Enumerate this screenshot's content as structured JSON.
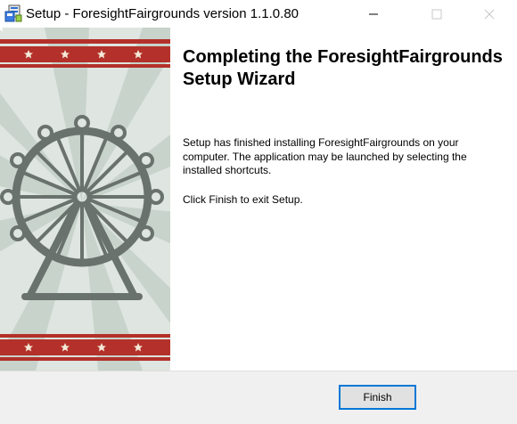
{
  "window": {
    "title": "Setup - ForesightFairgrounds version 1.1.0.80",
    "app_icon": "installer-box-icon",
    "controls": [
      "minimize-icon",
      "maximize-icon",
      "close-icon"
    ]
  },
  "banner": {
    "illustration": "ferris-wheel-illustration",
    "colors": {
      "background": "#dfe5e0",
      "ray": "#c7d3cb",
      "stripe": "#b3312a",
      "wheel": "#6a726d",
      "star": "#ffffff"
    }
  },
  "content": {
    "heading": "Completing the ForesightFairgrounds Setup Wizard",
    "paragraph1": "Setup has finished installing ForesightFairgrounds on your computer. The application may be launched by selecting the installed shortcuts.",
    "paragraph2": "Click Finish to exit Setup."
  },
  "footer": {
    "finish_label": "Finish",
    "accent": "#0078d7"
  }
}
